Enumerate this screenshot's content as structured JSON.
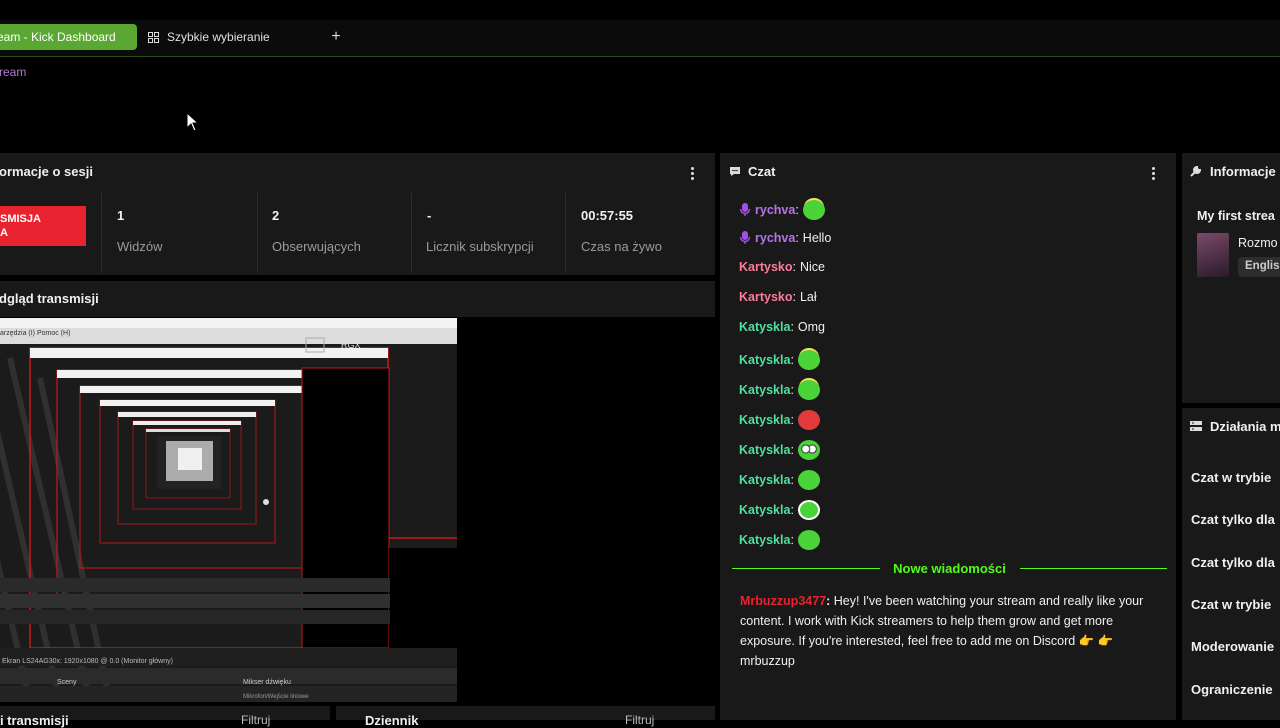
{
  "tabs": {
    "active_label": "eam - Kick Dashboard",
    "second_label": "Szybkie wybieranie",
    "add_label": "+"
  },
  "breadcrumb": "ream",
  "session_panel": {
    "title": "ormacje o sesji",
    "live_badge_line1": "SMISJA",
    "live_badge_line2": "A",
    "stats": [
      {
        "value": "1",
        "label": "Widzów"
      },
      {
        "value": "2",
        "label": "Obserwujących"
      },
      {
        "value": "-",
        "label": "Licznik subskrypcji"
      },
      {
        "value": "00:57:55",
        "label": "Czas na żywo"
      }
    ]
  },
  "preview_panel": {
    "title": "dgląd transmisji",
    "overlay_label": "RGX",
    "menu_text": "arzędzia (I)   Pomoc (H)",
    "rows": [
      {
        "left": "Ekran   LS24AG30x: 1920x1080 @ 0.0 (Monitor główny)"
      },
      {
        "left": "Sceny",
        "right": "Mikser dźwięku"
      },
      {
        "left": "",
        "right": "Mikrofon/Wejście liniowe"
      }
    ]
  },
  "chat_panel": {
    "title": "Czat",
    "messages": [
      {
        "user": "rychva",
        "text": "",
        "color": "#b574e8",
        "mic": true,
        "emote": "green-halo"
      },
      {
        "user": "rychva",
        "text": "Hello",
        "color": "#b574e8",
        "mic": true
      },
      {
        "user": "Kartysko",
        "text": "Nice",
        "color": "#ff7a9a"
      },
      {
        "user": "Kartysko",
        "text": "Lał",
        "color": "#ff7a9a"
      },
      {
        "user": "Katyskla",
        "text": "Omg",
        "color": "#4fe0a0"
      },
      {
        "user": "Katyskla",
        "text": "",
        "color": "#4fe0a0",
        "emote": "green-halo"
      },
      {
        "user": "Katyskla",
        "text": "",
        "color": "#4fe0a0",
        "emote": "green-halo"
      },
      {
        "user": "Katyskla",
        "text": "",
        "color": "#4fe0a0",
        "emote": "red-angry"
      },
      {
        "user": "Katyskla",
        "text": "",
        "color": "#4fe0a0",
        "emote": "green-glasses"
      },
      {
        "user": "Katyskla",
        "text": "",
        "color": "#4fe0a0",
        "emote": "green-smirk"
      },
      {
        "user": "Katyskla",
        "text": "",
        "color": "#4fe0a0",
        "emote": "green-headset"
      },
      {
        "user": "Katyskla",
        "text": "",
        "color": "#4fe0a0",
        "emote": "green-smile"
      }
    ],
    "new_messages_label": "Nowe wiadomości",
    "long_message": {
      "user": "Mrbuzzup3477",
      "user_color": "#e8222e",
      "text": "Hey! I've been watching your stream and really like your content. I work with Kick streamers to help them grow and get more exposure. If you're interested, feel free to add me on Discord 👉 👉 mrbuzzup"
    }
  },
  "info_panel": {
    "title": "Informacje",
    "stream_title": "My first strea",
    "category": "Rozmo",
    "language": "Englis"
  },
  "actions_panel": {
    "title": "Działania m",
    "items": [
      "Czat w trybie",
      "Czat tylko dla",
      "Czat tylko dla",
      "Czat w trybie",
      "Moderowanie",
      "Ograniczenie"
    ]
  },
  "bottom_panels": {
    "left_title": "ni transmisji",
    "left_filter": "Filtruj",
    "right_title": "Dziennik",
    "right_filter": "Filtruj"
  },
  "colors": {
    "kick_green": "#53fc18",
    "tab_green": "#5aa832",
    "live_red": "#e8222e",
    "panel_bg": "#191919"
  }
}
